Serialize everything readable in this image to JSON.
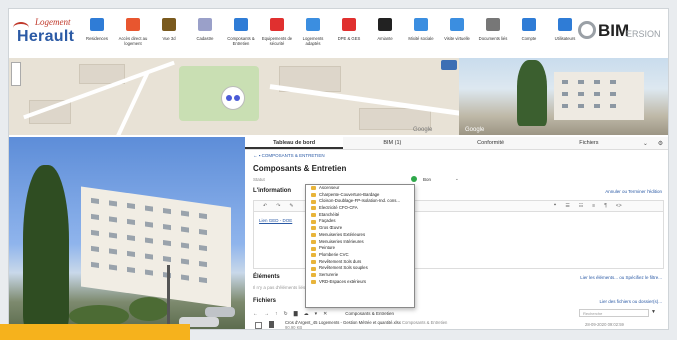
{
  "header": {
    "logo_line1": "Logement",
    "logo_line2": "Herault",
    "nav": [
      {
        "label": "Residences",
        "icon": "buildings-icon",
        "color": "#2f7cd6"
      },
      {
        "label": "Accès direct au logement",
        "icon": "home-icon",
        "color": "#e8562f"
      },
      {
        "label": "Vue 3d",
        "icon": "cube-icon",
        "color": "#7a5a1e"
      },
      {
        "label": "Cadastre",
        "icon": "cadastre-icon",
        "color": "#9aa0c9"
      },
      {
        "label": "Composants & Entretien",
        "icon": "layout-icon",
        "color": "#2f7cd6"
      },
      {
        "label": "Equipements de sécurité",
        "icon": "lock-icon",
        "color": "#e0302f"
      },
      {
        "label": "Logements adaptés",
        "icon": "wheelchair-icon",
        "color": "#3b8ee0"
      },
      {
        "label": "DPE & GES",
        "icon": "energy-icon",
        "color": "#e0302f"
      },
      {
        "label": "Amiante",
        "icon": "asbestos-icon",
        "color": "#222222"
      },
      {
        "label": "Mixité sociale",
        "icon": "people-icon",
        "color": "#3b8ee0"
      },
      {
        "label": "Visite virtuelle",
        "icon": "rotate-icon",
        "color": "#3b8ee0"
      },
      {
        "label": "Documents liés",
        "icon": "paperclip-icon",
        "color": "#777777"
      },
      {
        "label": "Compte",
        "icon": "account-icon",
        "color": "#2f7cd6"
      },
      {
        "label": "Utilisateurs",
        "icon": "users-icon",
        "color": "#2f7cd6"
      }
    ],
    "brand_main": "BIM",
    "brand_sub": "ERSION"
  },
  "map": {
    "google_text": "Google"
  },
  "panel": {
    "tabs": [
      "Tableau de bord",
      "BIM (1)",
      "Conformité",
      "Fichiers"
    ],
    "breadcrumb": "COMPOSANTS & ENTRETIEN",
    "title": "Composants & Entretien",
    "status_label": "Statut",
    "status_value": "Bon",
    "info_heading": "L'information",
    "info_link": "Annuler ou Terminer l'édition",
    "editor_link": "Lien GED - DOE",
    "elements_heading": "Éléments",
    "elements_link": "Lier les éléments... ou Spécifiez le filtre...",
    "elements_empty": "Il n'y a pas d'éléments liés",
    "files_heading": "Fichiers",
    "files_link": "Lier des fichiers ou dossier(s)...",
    "files_folder": "Composants & Entretien",
    "files_search_placeholder": "Recherche",
    "file_row": {
      "name": "Cros d'Argent_45 Logements - Gestion Métrée et quantité.xlsx",
      "folder": "Composants & Entretien",
      "size": "90.90 KB",
      "date": "28-09-2020 09:02:59"
    }
  },
  "dropdown": {
    "items": [
      "Ascenseur",
      "Charpente-Couverture-Bardage",
      "Cloison-Doublage-FP-Isolation-Ind. cons...",
      "Electricité CFO-CFA",
      "Etanchéité",
      "Façades",
      "Gros Œuvre",
      "Menuiseries Extérieures",
      "Menuiseries Intérieures",
      "Peinture",
      "Plomberie CVC",
      "Revêtement Sols durs",
      "Revêtement Sols souples",
      "Serrurerie",
      "VRD-Espaces extérieurs"
    ]
  }
}
